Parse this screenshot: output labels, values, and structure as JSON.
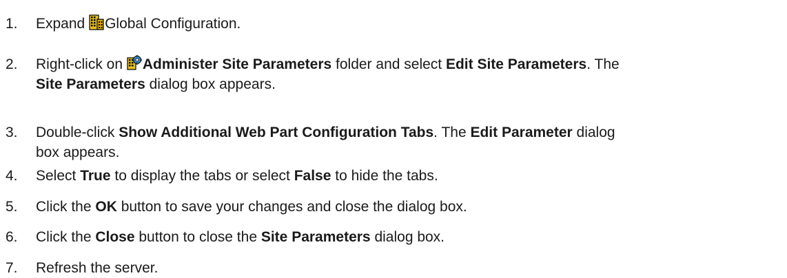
{
  "steps": [
    {
      "num": "1.",
      "parts": [
        {
          "text": "Expand ",
          "bold": false
        },
        {
          "icon": "global-configuration-icon"
        },
        {
          "text": "Global Configuration.",
          "bold": false
        }
      ]
    },
    {
      "num": "2.",
      "parts": [
        {
          "text": "Right-click on ",
          "bold": false
        },
        {
          "icon": "administer-site-parameters-icon"
        },
        {
          "text": "Administer Site Parameters",
          "bold": true
        },
        {
          "text": " folder and select ",
          "bold": false
        },
        {
          "text": "Edit Site Parameters",
          "bold": true
        },
        {
          "text": ". The",
          "bold": false
        },
        {
          "text": "Site Parameters",
          "bold": true
        },
        {
          "text": " dialog box appears.",
          "bold": false
        }
      ]
    },
    {
      "num": "3.",
      "parts": [
        {
          "text": "Double-click ",
          "bold": false
        },
        {
          "text": "Show Additional Web Part Configuration Tabs",
          "bold": true
        },
        {
          "text": ". The ",
          "bold": false
        },
        {
          "text": "Edit Parameter",
          "bold": true
        },
        {
          "text": " dialog",
          "bold": false
        },
        {
          "text": "box appears.",
          "bold": false
        }
      ]
    },
    {
      "num": "4.",
      "parts": [
        {
          "text": "Select ",
          "bold": false
        },
        {
          "text": "True",
          "bold": true
        },
        {
          "text": " to display the tabs or select ",
          "bold": false
        },
        {
          "text": "False",
          "bold": true
        },
        {
          "text": " to hide the tabs.",
          "bold": false
        }
      ]
    },
    {
      "num": "5.",
      "parts": [
        {
          "text": "Click the ",
          "bold": false
        },
        {
          "text": "OK",
          "bold": true
        },
        {
          "text": " button to save your changes and close the dialog box.",
          "bold": false
        }
      ]
    },
    {
      "num": "6.",
      "parts": [
        {
          "text": "Click the ",
          "bold": false
        },
        {
          "text": "Close",
          "bold": true
        },
        {
          "text": " button to close the ",
          "bold": false
        },
        {
          "text": "Site Parameters",
          "bold": true
        },
        {
          "text": " dialog box.",
          "bold": false
        }
      ]
    },
    {
      "num": "7.",
      "parts": [
        {
          "text": "Refresh the server.",
          "bold": false
        }
      ]
    }
  ]
}
